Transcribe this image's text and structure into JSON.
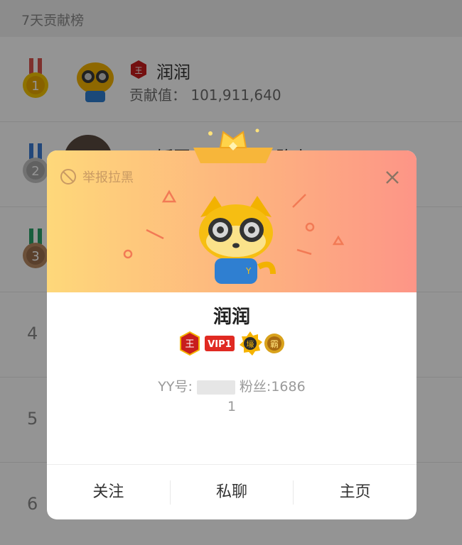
{
  "board": {
    "title": "7天贡献榜",
    "rows": [
      {
        "rank": "1",
        "name": "润润",
        "sub": "贡献值： 101,911,640"
      },
      {
        "rank": "2",
        "name": "饭团…………在路上",
        "sub": ""
      },
      {
        "rank": "3",
        "name": "",
        "sub": ""
      },
      {
        "rank": "4",
        "name": "",
        "sub": ""
      },
      {
        "rank": "5",
        "name": "",
        "sub": ""
      },
      {
        "rank": "6",
        "name": "",
        "sub": ""
      }
    ]
  },
  "modal": {
    "report_label": "举报拉黑",
    "name": "润润",
    "badges": [
      "王",
      "VIP1",
      "壕",
      "霸"
    ],
    "yy_label": "YY号:",
    "fans_label": "粉丝:1686",
    "fans_cont": "1",
    "actions": {
      "follow": "关注",
      "message": "私聊",
      "homepage": "主页"
    }
  },
  "colors": {
    "gradient_start": "#fed87a",
    "gradient_end": "#fd9587",
    "badge_red": "#e02a22",
    "gold": "#f5b300"
  }
}
